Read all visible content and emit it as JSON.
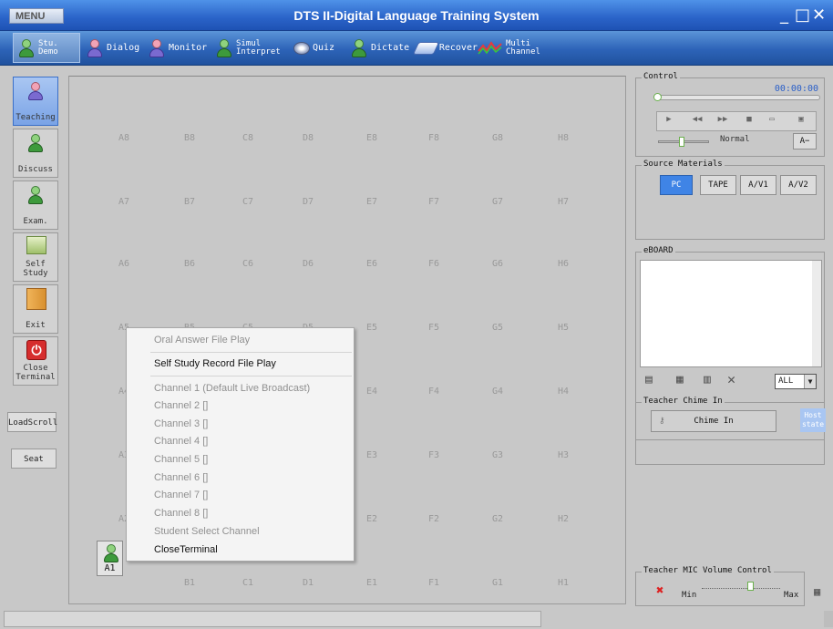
{
  "window": {
    "menu_label": "MENU",
    "title": "DTS II-Digital Language Training System",
    "min_glyph": "_",
    "max_glyph": "□",
    "close_glyph": "✕"
  },
  "toolbar": [
    {
      "label": "Stu.\nDemo",
      "icon": "student-demo-icon"
    },
    {
      "label": "Dialog",
      "icon": "dialog-icon"
    },
    {
      "label": "Monitor",
      "icon": "monitor-icon"
    },
    {
      "label": "Simul\nInterpret",
      "icon": "simul-interpret-icon"
    },
    {
      "label": "Quiz",
      "icon": "quiz-icon"
    },
    {
      "label": "Dictate",
      "icon": "dictate-icon"
    },
    {
      "label": "Recover",
      "icon": "recover-icon"
    },
    {
      "label": "Multi\nChannel",
      "icon": "multi-channel-icon"
    }
  ],
  "sidebar": {
    "items": [
      {
        "label": "Teaching",
        "icon": "teaching-icon"
      },
      {
        "label": "Discuss",
        "icon": "discuss-icon"
      },
      {
        "label": "Exam.",
        "icon": "exam-icon"
      },
      {
        "label": "Self\nStudy",
        "icon": "self-study-icon"
      },
      {
        "label": "Exit",
        "icon": "exit-door-icon"
      },
      {
        "label": "Close\nTerminal",
        "icon": "power-icon"
      }
    ],
    "load_scroll": "LoadScroll",
    "seat": "Seat"
  },
  "seats": {
    "rows": [
      "8",
      "7",
      "6",
      "5",
      "4",
      "3",
      "2",
      "1"
    ],
    "cols": [
      "A",
      "B",
      "C",
      "D",
      "E",
      "F",
      "G",
      "H"
    ],
    "active_seat": "A1"
  },
  "context_menu": {
    "items": [
      {
        "label": "Oral Answer File Play",
        "enabled": false
      },
      {
        "label": "Self Study Record File Play",
        "enabled": true
      },
      {
        "label": "Channel 1 (Default Live Broadcast)",
        "enabled": false
      },
      {
        "label": "Channel 2 []",
        "enabled": false
      },
      {
        "label": "Channel 3 []",
        "enabled": false
      },
      {
        "label": "Channel 4 []",
        "enabled": false
      },
      {
        "label": "Channel 5 []",
        "enabled": false
      },
      {
        "label": "Channel 6 []",
        "enabled": false
      },
      {
        "label": "Channel 7 []",
        "enabled": false
      },
      {
        "label": "Channel 8 []",
        "enabled": false
      },
      {
        "label": "Student Select Channel",
        "enabled": false
      },
      {
        "label": "CloseTerminal",
        "enabled": true
      }
    ]
  },
  "control": {
    "title": "Control",
    "time": "00:00:00",
    "speed_label": "Normal",
    "a_minus": "A−",
    "play": "▶",
    "rewind": "◀◀",
    "forward": "▶▶",
    "stop": "■"
  },
  "source": {
    "title": "Source Materials",
    "buttons": [
      "PC",
      "TAPE",
      "A/V1",
      "A/V2"
    ],
    "selected": "PC"
  },
  "eboard": {
    "title": "eBOARD",
    "filter_value": "ALL",
    "delete_glyph": "✕"
  },
  "chime": {
    "title": "Teacher Chime In",
    "button": "Chime In",
    "host_state": "Host\nstate"
  },
  "mic": {
    "title": "Teacher MIC Volume Control",
    "min": "Min",
    "max": "Max"
  }
}
